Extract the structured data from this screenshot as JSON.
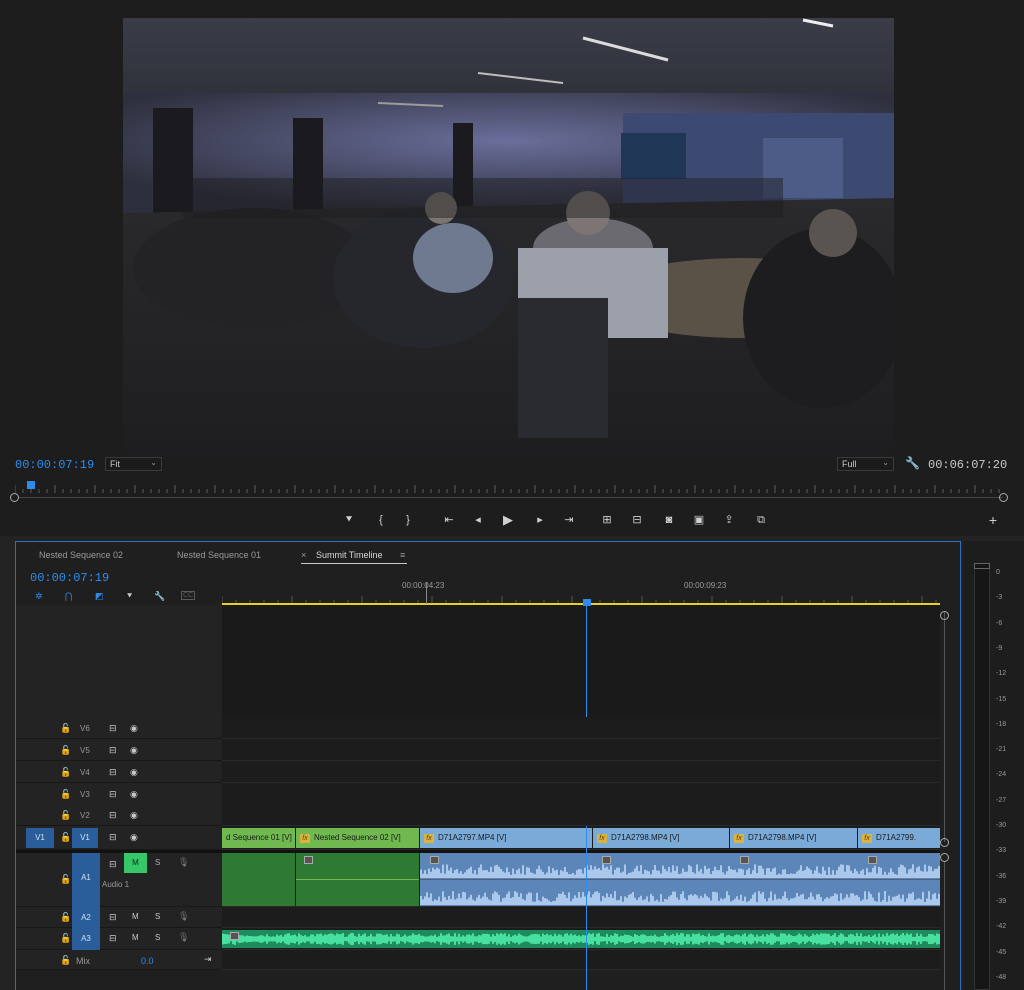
{
  "monitor": {
    "current_timecode": "00:00:07:19",
    "fit_label": "Fit",
    "quality_label": "Full",
    "duration_timecode": "00:06:07:20"
  },
  "timeline": {
    "tabs": [
      "Nested Sequence 02",
      "Nested Sequence 01",
      "Summit Timeline"
    ],
    "close_glyph": "×",
    "menu_glyph": "≡",
    "timecode": "00:00:07:19",
    "ruler": [
      "00:00:04:23",
      "00:00:09:23"
    ],
    "video_tracks": [
      "V6",
      "V5",
      "V4",
      "V3",
      "V2",
      "V1"
    ],
    "source_patch_v": "V1",
    "audio_tracks": [
      "A1",
      "A2",
      "A3"
    ],
    "audio1_name": "Audio 1",
    "mix_label": "Mix",
    "mix_value": "0.0",
    "mute_label": "M",
    "solo_label": "S",
    "clips": {
      "v1_a": "d Sequence 01 [V]",
      "v1_b": "Nested Sequence 02 [V]",
      "v1_c": "D71A2797.MP4 [V]",
      "v1_d": "D71A2798.MP4 [V]",
      "v1_e": "D71A2798.MP4 [V]",
      "v1_f": "D71A2799."
    },
    "fx_label": "fx",
    "cc_label": "CC"
  },
  "meter": {
    "db_labels": [
      "0",
      "-3",
      "-6",
      "-9",
      "-12",
      "-15",
      "-18",
      "-21",
      "-24",
      "-27",
      "-30",
      "-33",
      "-36",
      "-39",
      "-42",
      "-45",
      "-48"
    ]
  },
  "colors": {
    "accent": "#2d8ceb",
    "video_clip": "#7aaad8",
    "nested_clip": "#6fb950",
    "audio_green": "#2fc48a",
    "yellow_bar": "#e5d125"
  }
}
